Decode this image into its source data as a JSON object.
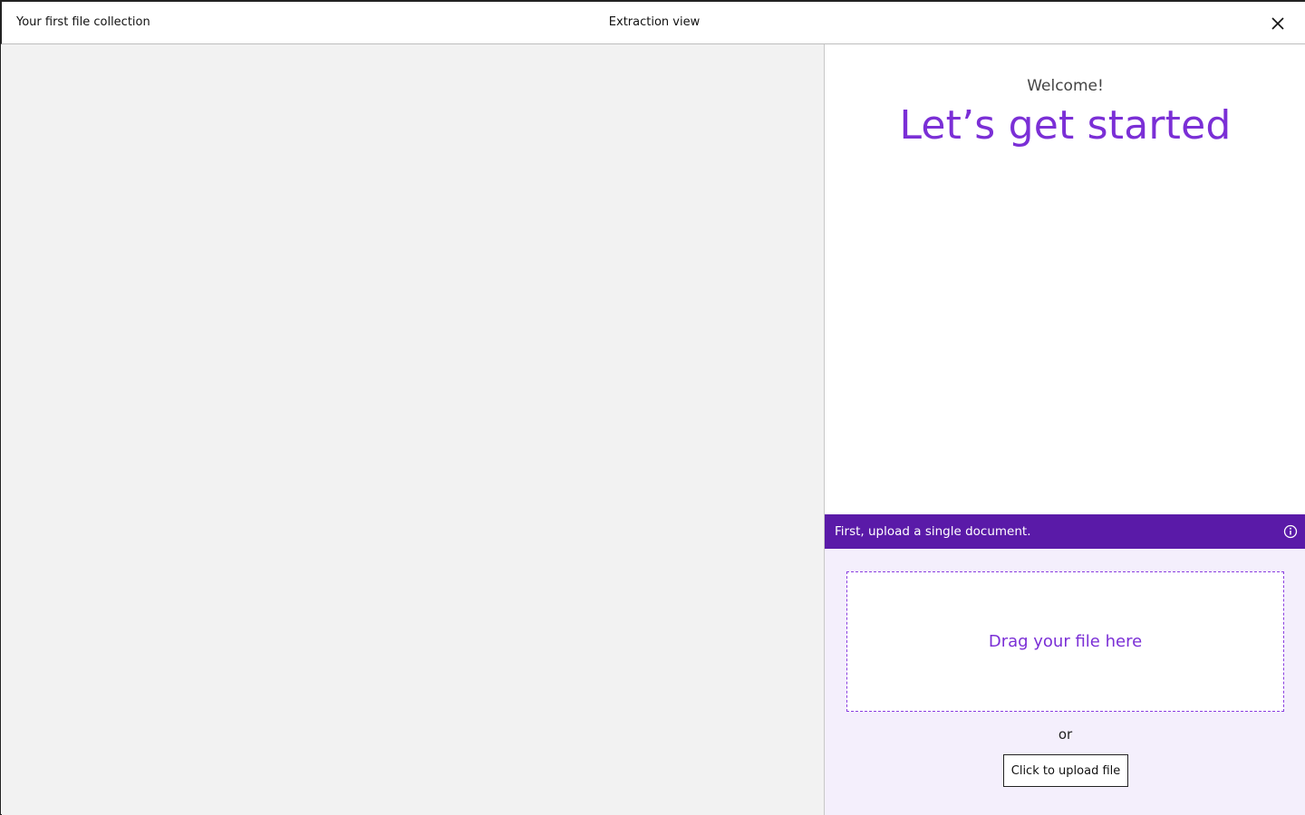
{
  "header": {
    "collection_title": "Your first file collection",
    "view_title": "Extraction view",
    "close_icon": "close-icon"
  },
  "panel": {
    "welcome": "Welcome!",
    "headline": "Let’s get started",
    "step_text": "First, upload a single document.",
    "info_icon": "info-icon",
    "dropzone_label": "Drag your file here",
    "or_text": "or",
    "upload_button": "Click to upload file"
  },
  "colors": {
    "accent": "#7b2fd6",
    "banner": "#5a1aa8",
    "upload_bg": "#f4effc",
    "canvas_bg": "#f2f2f2"
  }
}
